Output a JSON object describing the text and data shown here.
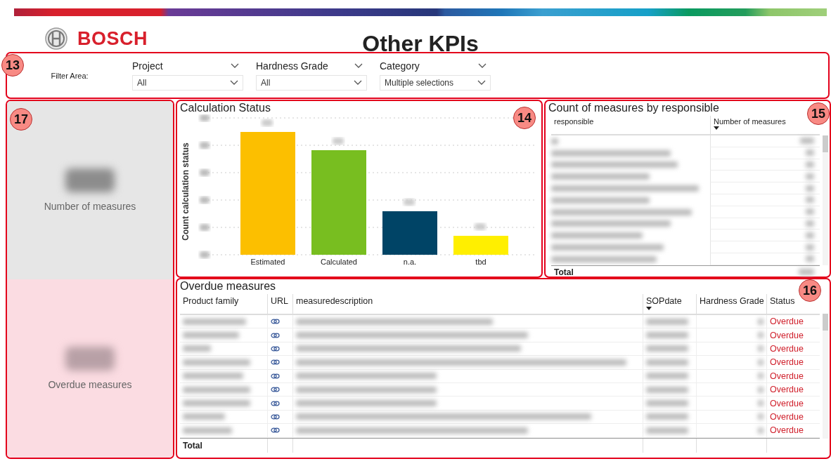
{
  "header": {
    "logo_text": "BOSCH",
    "title": "Other KPIs"
  },
  "filter_area": {
    "callout": "13",
    "label": "Filter Area:",
    "filters": [
      {
        "label": "Project",
        "value": "All"
      },
      {
        "label": "Hardness Grade",
        "value": "All"
      },
      {
        "label": "Category",
        "value": "Multiple selections"
      }
    ]
  },
  "kpi_cards": {
    "callout": "17",
    "cards": [
      {
        "label": "Number of measures",
        "kind": "neutral"
      },
      {
        "label": "Overdue measures",
        "kind": "alert"
      }
    ]
  },
  "calculation_status": {
    "callout": "14",
    "title": "Calculation Status",
    "ylabel": "Count calculation status",
    "bars": [
      {
        "label": "Estimated",
        "color": "#fcbf00"
      },
      {
        "label": "Calculated",
        "color": "#78be20"
      },
      {
        "label": "n.a.",
        "color": "#004466"
      },
      {
        "label": "tbd",
        "color": "#ffef00"
      }
    ]
  },
  "responsible_table": {
    "callout": "15",
    "title": "Count of measures by responsible",
    "columns": [
      {
        "label": "responsible",
        "sorted": false
      },
      {
        "label": "Number of measures",
        "sorted": true
      }
    ],
    "total_label": "Total"
  },
  "overdue_table": {
    "callout": "16",
    "title": "Overdue measures",
    "columns": [
      {
        "label": "Product family",
        "sorted": false
      },
      {
        "label": "URL",
        "sorted": false
      },
      {
        "label": "measuredescription",
        "sorted": false
      },
      {
        "label": "SOPdate",
        "sorted": true
      },
      {
        "label": "Hardness Grade",
        "sorted": false
      },
      {
        "label": "Status",
        "sorted": false
      }
    ],
    "rows": [
      {
        "status": "Overdue"
      },
      {
        "status": "Overdue"
      },
      {
        "status": "Overdue"
      },
      {
        "status": "Overdue"
      },
      {
        "status": "Overdue"
      },
      {
        "status": "Overdue"
      },
      {
        "status": "Overdue"
      },
      {
        "status": "Overdue"
      },
      {
        "status": "Overdue"
      }
    ],
    "total_label": "Total"
  }
}
